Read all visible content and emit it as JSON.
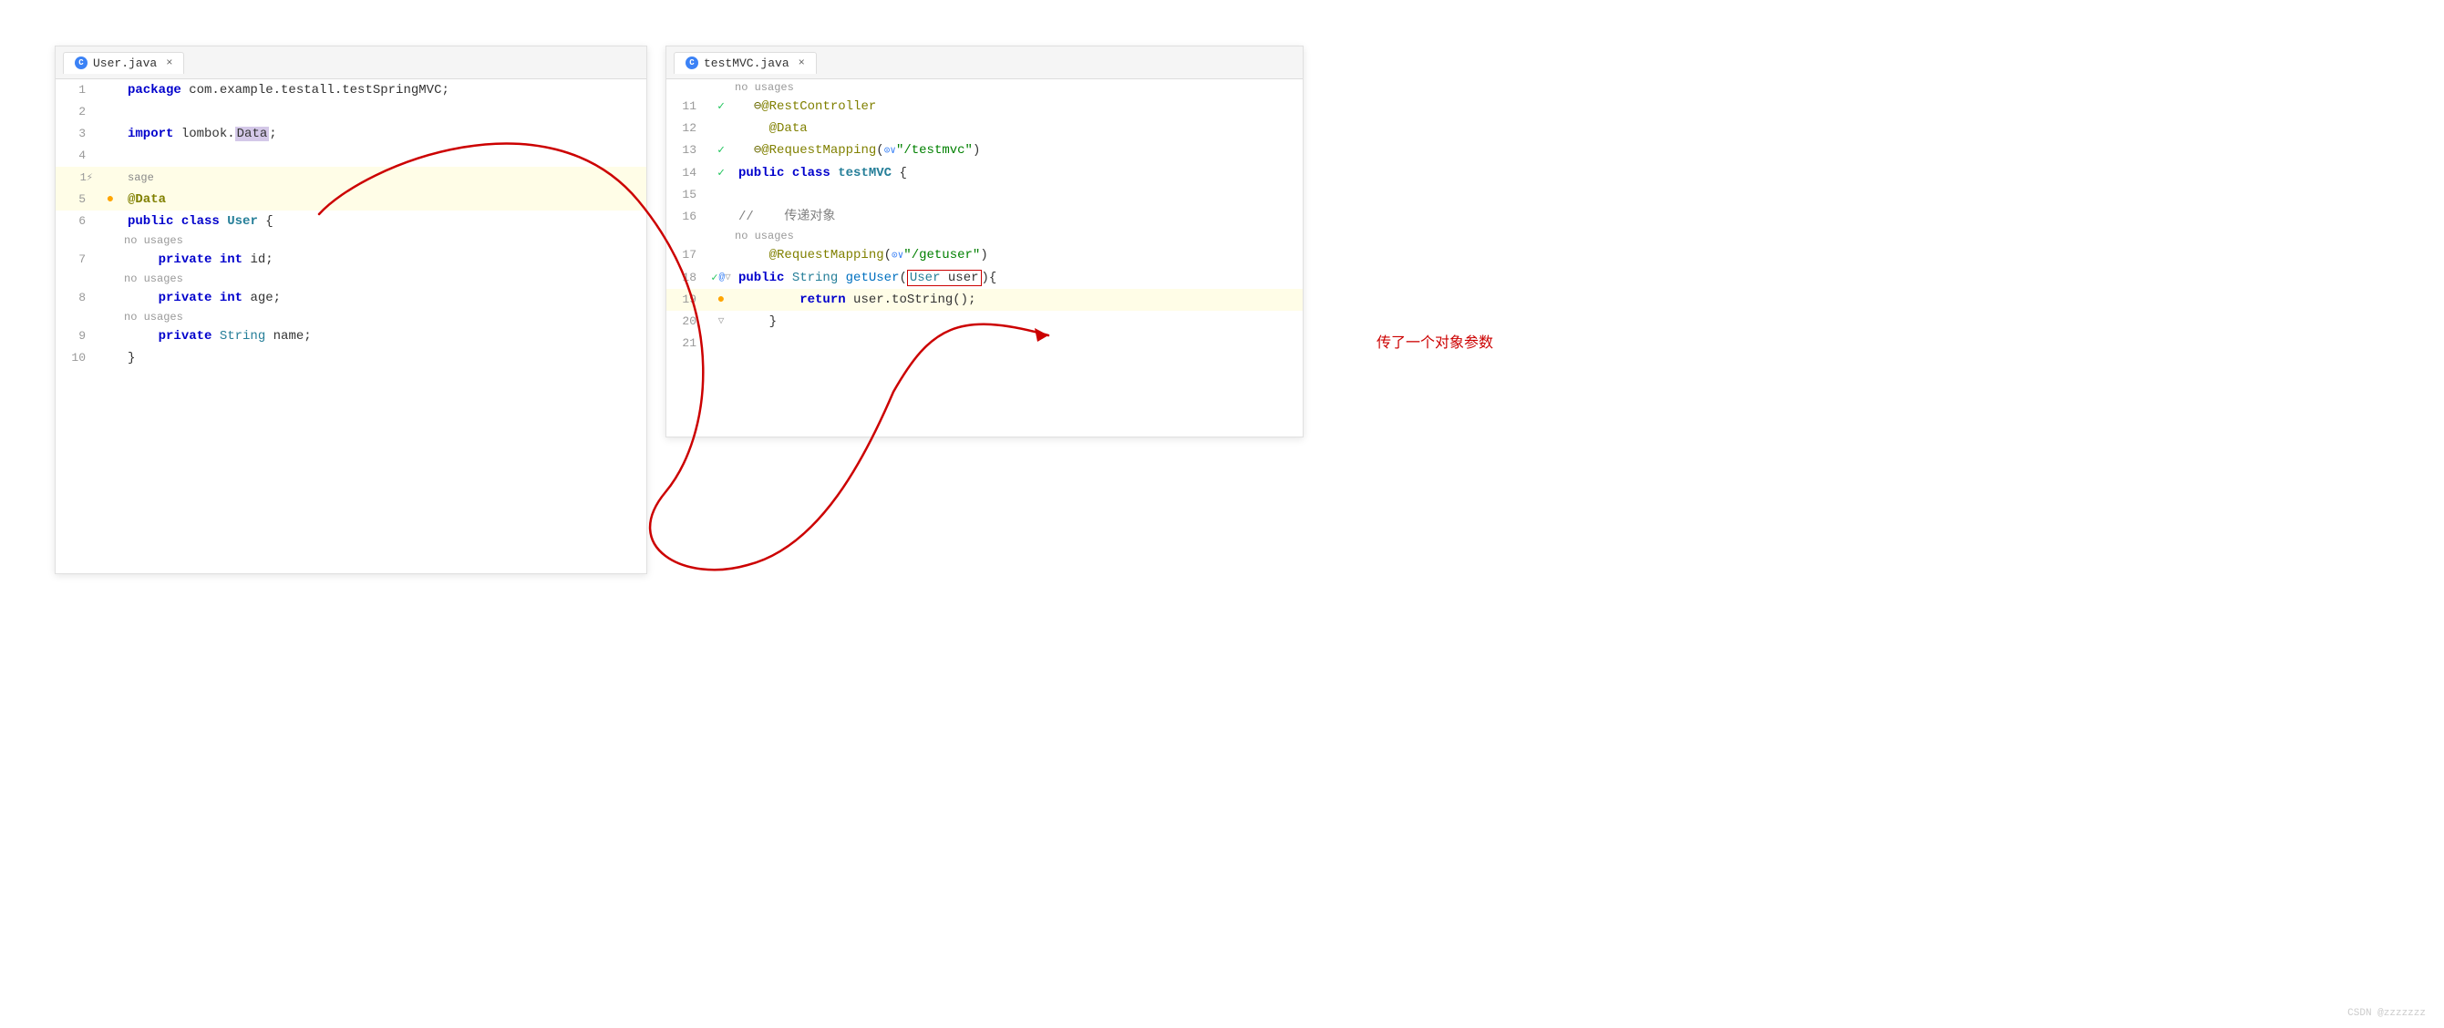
{
  "left_panel": {
    "tab_label": "User.java",
    "tab_icon": "C",
    "lines": [
      {
        "num": "1",
        "content": "package com.example.testall.testSpringMVC;",
        "type": "normal"
      },
      {
        "num": "2",
        "content": "",
        "type": "normal"
      },
      {
        "num": "3",
        "content": "import lombok.Data;",
        "type": "normal"
      },
      {
        "num": "4",
        "content": "",
        "type": "normal"
      },
      {
        "num": "5",
        "content": "@Data",
        "type": "highlighted",
        "sub": "1 usage"
      },
      {
        "num": "6",
        "content": "public class User {",
        "type": "normal"
      },
      {
        "num": "7",
        "content": "    private int id;",
        "type": "normal",
        "sub": "no usages"
      },
      {
        "num": "8",
        "content": "    private int age;",
        "type": "normal",
        "sub": "no usages"
      },
      {
        "num": "9",
        "content": "    private String name;",
        "type": "normal",
        "sub": "no usages"
      },
      {
        "num": "10",
        "content": "}",
        "type": "normal"
      }
    ]
  },
  "right_panel": {
    "tab_label": "testMVC.java",
    "tab_icon": "C",
    "lines": [
      {
        "num": "11",
        "content": "@RestController",
        "type": "normal",
        "gutter": "check"
      },
      {
        "num": "12",
        "content": "    @Data",
        "type": "normal"
      },
      {
        "num": "13",
        "content": "@RequestMapping(☉∨\"/testmvc\")",
        "type": "normal",
        "gutter": "check"
      },
      {
        "num": "14",
        "content": "public class testMVC {",
        "type": "normal",
        "gutter": "check"
      },
      {
        "num": "15",
        "content": "",
        "type": "normal"
      },
      {
        "num": "16",
        "content": "//    传递对象",
        "type": "normal"
      },
      {
        "num": "17",
        "content": "    @RequestMapping(☉∨\"/getuser\")",
        "type": "normal",
        "sub": "no usages"
      },
      {
        "num": "18",
        "content": "    public String getUser(User user){",
        "type": "normal",
        "gutter": "multi"
      },
      {
        "num": "19",
        "content": "        return user.toString();",
        "type": "highlighted"
      },
      {
        "num": "20",
        "content": "    }",
        "type": "normal",
        "gutter": "fold"
      },
      {
        "num": "21",
        "content": "",
        "type": "normal"
      }
    ]
  },
  "annotation": {
    "label": "传了一个对象参数",
    "box_text": "(User user){"
  },
  "watermark": "CSDN @zzzzzzz",
  "no_usages_text": "no usages",
  "package_text": "package",
  "import_text": "import",
  "public_text": "public",
  "class_text": "class",
  "private_text": "private",
  "string_text": "String",
  "return_text": "return",
  "int_text": "int"
}
